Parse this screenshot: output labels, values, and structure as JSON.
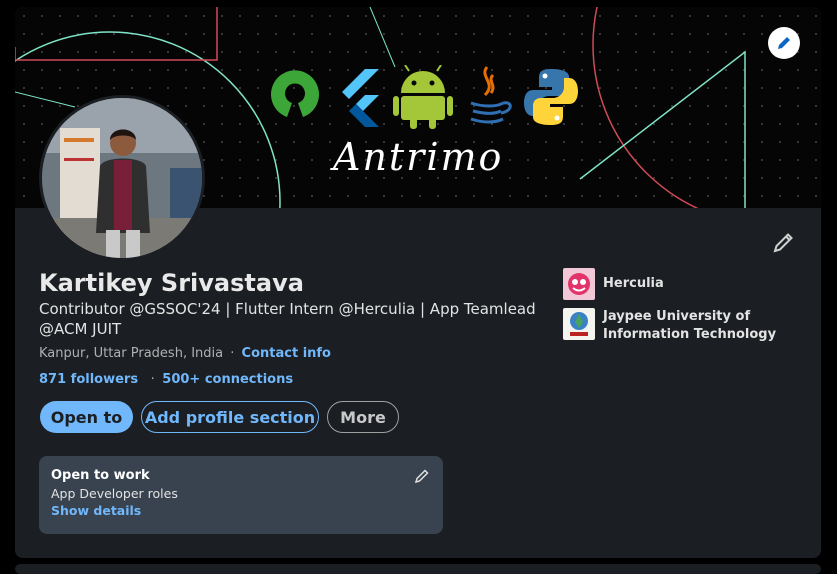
{
  "banner": {
    "signature": "Antrimo",
    "logos": [
      "open-source-icon",
      "flutter-icon",
      "android-icon",
      "java-icon",
      "python-icon"
    ]
  },
  "profile": {
    "name": "Kartikey Srivastava",
    "headline": "Contributor @GSSOC'24 | Flutter Intern @Herculia | App Teamlead @ACM JUIT",
    "location": "Kanpur, Uttar Pradesh, India",
    "location_separator": "·",
    "contact_label": "Contact info",
    "followers": "871 followers",
    "connections_separator": "·",
    "connections": "500+ connections"
  },
  "actions": {
    "open_to": "Open to",
    "add_section": "Add profile section",
    "more": "More"
  },
  "orgs": [
    {
      "name": "Herculia"
    },
    {
      "name": "Jaypee University of Information Technology"
    }
  ],
  "open_to_work": {
    "title": "Open to work",
    "roles": "App Developer roles",
    "link": "Show details"
  },
  "colors": {
    "accent": "#71b7fb",
    "card_bg": "#1b1f23",
    "otw_bg": "#38434f"
  }
}
